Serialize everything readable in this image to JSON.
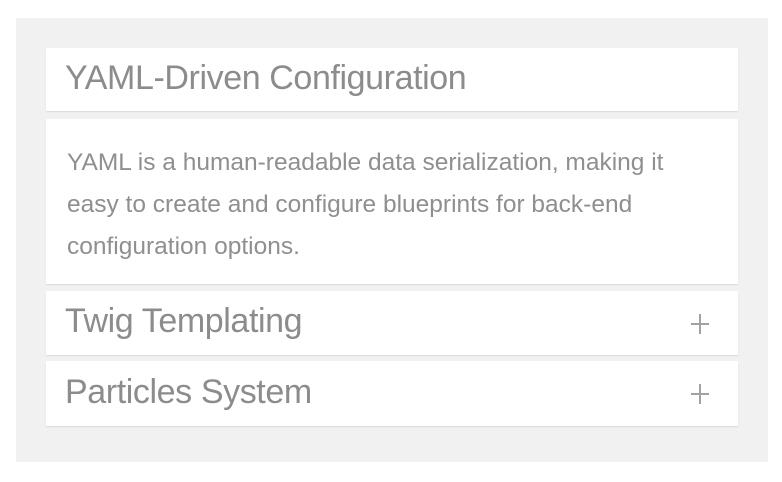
{
  "accordion": {
    "items": [
      {
        "title": "YAML-Driven Configuration",
        "expanded": true,
        "body": "YAML is a human-readable data serialization, making it easy to create and configure blueprints for back-end configuration options."
      },
      {
        "title": "Twig Templating",
        "expanded": false,
        "toggle_icon": "plus-icon"
      },
      {
        "title": "Particles System",
        "expanded": false,
        "toggle_icon": "plus-icon"
      }
    ]
  }
}
